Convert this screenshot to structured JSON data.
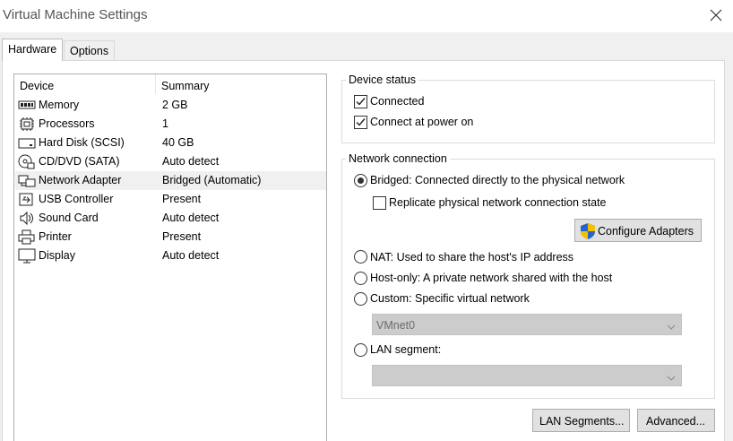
{
  "window": {
    "title": "Virtual Machine Settings"
  },
  "tabs": [
    {
      "label": "Hardware",
      "active": true
    },
    {
      "label": "Options",
      "active": false
    }
  ],
  "device_list": {
    "columns": [
      "Device",
      "Summary"
    ],
    "rows": [
      {
        "icon": "memory-icon",
        "device": "Memory",
        "summary": "2 GB"
      },
      {
        "icon": "processor-icon",
        "device": "Processors",
        "summary": "1"
      },
      {
        "icon": "hard-disk-icon",
        "device": "Hard Disk (SCSI)",
        "summary": "40 GB"
      },
      {
        "icon": "cd-dvd-icon",
        "device": "CD/DVD (SATA)",
        "summary": "Auto detect"
      },
      {
        "icon": "network-adapter-icon",
        "device": "Network Adapter",
        "summary": "Bridged (Automatic)",
        "selected": true
      },
      {
        "icon": "usb-icon",
        "device": "USB Controller",
        "summary": "Present"
      },
      {
        "icon": "sound-card-icon",
        "device": "Sound Card",
        "summary": "Auto detect"
      },
      {
        "icon": "printer-icon",
        "device": "Printer",
        "summary": "Present"
      },
      {
        "icon": "display-icon",
        "device": "Display",
        "summary": "Auto detect"
      }
    ]
  },
  "device_status": {
    "title": "Device status",
    "connected": {
      "label": "Connected",
      "checked": true
    },
    "connect_at_power_on": {
      "label": "Connect at power on",
      "checked": true
    }
  },
  "network_connection": {
    "title": "Network connection",
    "bridged": {
      "label": "Bridged: Connected directly to the physical network",
      "selected": true
    },
    "replicate": {
      "label": "Replicate physical network connection state",
      "checked": false
    },
    "configure_adapters": {
      "label": "Configure Adapters",
      "icon": "uac-shield-icon"
    },
    "nat": {
      "label": "NAT: Used to share the host's IP address",
      "selected": false
    },
    "host_only": {
      "label": "Host-only: A private network shared with the host",
      "selected": false
    },
    "custom": {
      "label": "Custom: Specific virtual network",
      "selected": false
    },
    "custom_select": {
      "value": "VMnet0",
      "enabled": false
    },
    "lan_segment": {
      "label": "LAN segment:",
      "selected": false
    },
    "lan_segment_select": {
      "value": "",
      "enabled": false
    }
  },
  "buttons": {
    "lan_segments": "LAN Segments...",
    "advanced": "Advanced..."
  },
  "colors": {
    "dialog_bg": "#f0f0f0",
    "button_bg": "#e1e1e1",
    "selected_row": "#f0f0f0",
    "shield_blue": "#2a62c9",
    "shield_yellow": "#f2c200"
  }
}
